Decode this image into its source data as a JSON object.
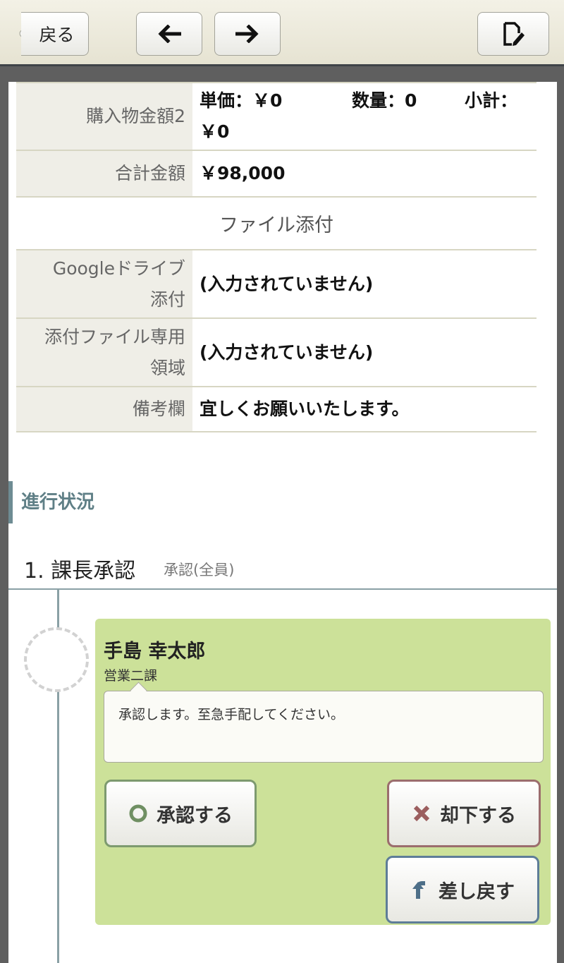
{
  "toolbar": {
    "back_label": "戻る",
    "icons": {
      "prev": "left-arrow-icon",
      "next": "right-arrow-icon",
      "edit": "edit-document-icon"
    }
  },
  "details": {
    "purchase2": {
      "label": "購入物金額2",
      "unit_price": "単価：￥0",
      "quantity": "数量：0",
      "subtotal_label": "小計：",
      "subtotal_value": "￥0"
    },
    "total": {
      "label": "合計金額",
      "value": "￥98,000"
    },
    "attachments_section": "ファイル添付",
    "google_drive": {
      "label_line1": "Googleドライブ",
      "label_line2": "添付",
      "value": "(入力されていません)"
    },
    "attachment_area": {
      "label_line1": "添付ファイル専用",
      "label_line2": "領域",
      "value": "(入力されていません)"
    },
    "remarks": {
      "label": "備考欄",
      "value": "宜しくお願いいたします。"
    }
  },
  "progress": {
    "heading": "進行状況",
    "step": {
      "title": "1. 課長承認",
      "subtitle": "承認(全員)",
      "approver": {
        "name": "手島 幸太郎",
        "department": "営業二課",
        "comment": "承認します。至急手配してください。"
      },
      "actions": {
        "approve": "承認する",
        "reject": "却下する",
        "remand": "差し戻す"
      }
    }
  },
  "colors": {
    "card_green": "#cce199",
    "accent_teal": "#6e8c93",
    "approve_border": "#7d9a6f",
    "reject_border": "#9b6d6d",
    "remand_border": "#5e7d98"
  }
}
